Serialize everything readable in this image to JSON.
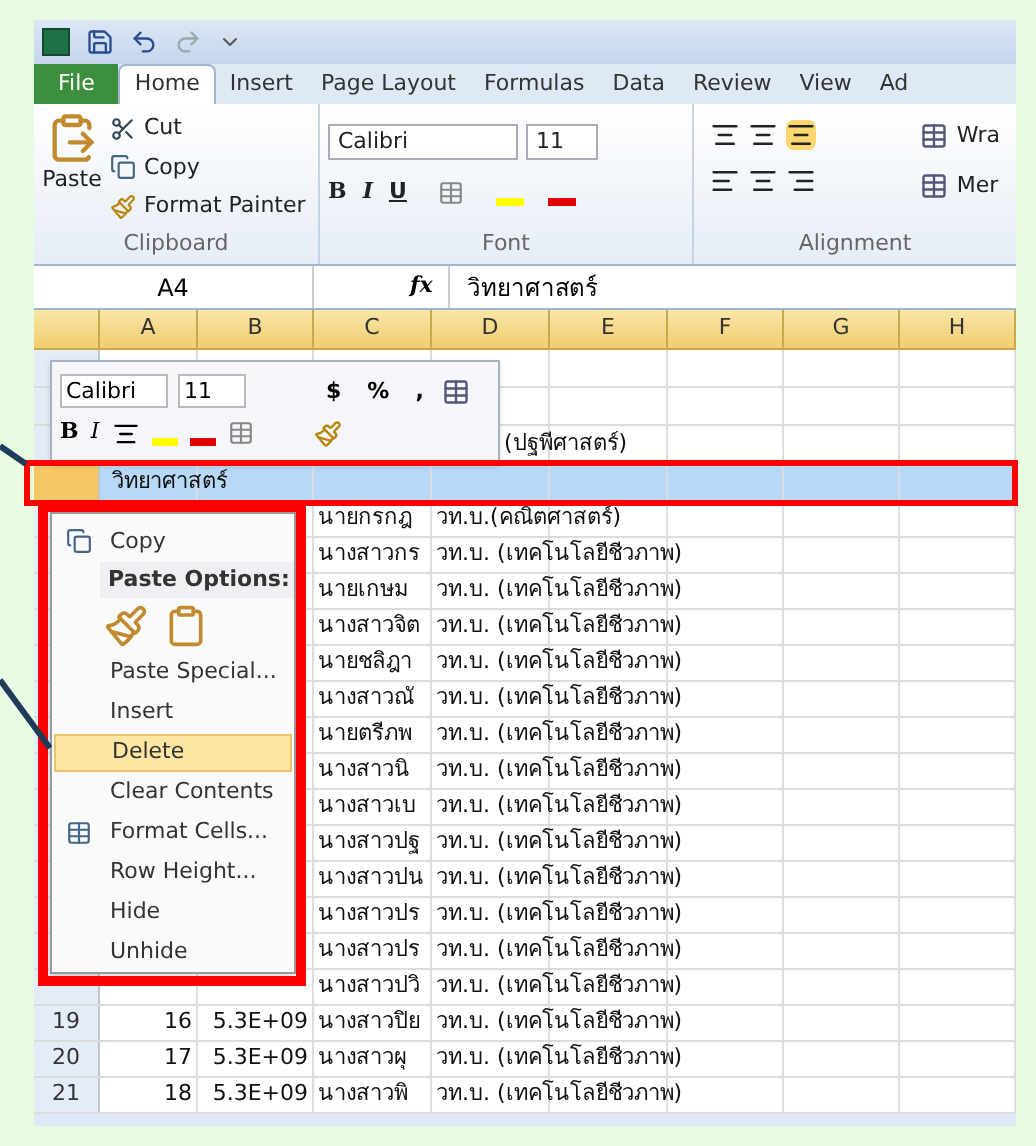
{
  "tabs": [
    {
      "label": "File",
      "kind": "file",
      "selected": false
    },
    {
      "label": "Home",
      "kind": "tab",
      "selected": true
    },
    {
      "label": "Insert",
      "kind": "tab",
      "selected": false
    },
    {
      "label": "Page Layout",
      "kind": "tab",
      "selected": false
    },
    {
      "label": "Formulas",
      "kind": "tab",
      "selected": false
    },
    {
      "label": "Data",
      "kind": "tab",
      "selected": false
    },
    {
      "label": "Review",
      "kind": "tab",
      "selected": false
    },
    {
      "label": "View",
      "kind": "tab",
      "selected": false
    },
    {
      "label": "Ad",
      "kind": "tab",
      "selected": false
    }
  ],
  "ribbon": {
    "clipboard": {
      "paste": "Paste",
      "cut": "Cut",
      "copy": "Copy",
      "format_painter": "Format Painter",
      "label": "Clipboard"
    },
    "font": {
      "name": "Calibri",
      "size": "11",
      "bold": "B",
      "italic": "I",
      "underline": "U",
      "label": "Font"
    },
    "alignment": {
      "wrap": "Wra",
      "merge": "Mer",
      "label": "Alignment"
    }
  },
  "formula_bar": {
    "name_box": "A4",
    "fx": "fx",
    "value": "วิทยาศาสตร์"
  },
  "columns": [
    "A",
    "B",
    "C",
    "D",
    "E",
    "F",
    "G",
    "H"
  ],
  "rows": [
    {
      "selected": false,
      "cells": {}
    },
    {
      "selected": false,
      "cells": {}
    },
    {
      "selected": false,
      "cells": {
        "D": "(ปฐพีศาสตร์)"
      }
    },
    {
      "selected": true,
      "cells": {
        "A": "วิทยาศาสตร์"
      }
    },
    {
      "selected": false,
      "cells": {
        "C": "นายกรกฎ",
        "D": "วท.บ.(คณิตศาสตร์)"
      }
    },
    {
      "selected": false,
      "cells": {
        "C": "นางสาวกร",
        "D": "วท.บ. (เทคโนโลยีชีวภาพ)"
      }
    },
    {
      "selected": false,
      "cells": {
        "C": "นายเกษม",
        "D": "วท.บ. (เทคโนโลยีชีวภาพ)"
      }
    },
    {
      "selected": false,
      "cells": {
        "C": "นางสาวจิต",
        "D": "วท.บ. (เทคโนโลยีชีวภาพ)"
      }
    },
    {
      "selected": false,
      "cells": {
        "C": "นายชลิฎา",
        "D": "วท.บ. (เทคโนโลยีชีวภาพ)"
      }
    },
    {
      "selected": false,
      "cells": {
        "C": "นางสาวณั",
        "D": "วท.บ. (เทคโนโลยีชีวภาพ)"
      }
    },
    {
      "selected": false,
      "cells": {
        "C": "นายตรีภพ",
        "D": "วท.บ. (เทคโนโลยีชีวภาพ)"
      }
    },
    {
      "selected": false,
      "cells": {
        "C": "นางสาวนิ",
        "D": "วท.บ. (เทคโนโลยีชีวภาพ)"
      }
    },
    {
      "selected": false,
      "cells": {
        "C": "นางสาวเบ",
        "D": "วท.บ. (เทคโนโลยีชีวภาพ)"
      }
    },
    {
      "selected": false,
      "cells": {
        "C": "นางสาวปฐ",
        "D": "วท.บ. (เทคโนโลยีชีวภาพ)"
      }
    },
    {
      "selected": false,
      "cells": {
        "C": "นางสาวปน",
        "D": "วท.บ. (เทคโนโลยีชีวภาพ)"
      }
    },
    {
      "selected": false,
      "cells": {
        "C": "นางสาวปร",
        "D": "วท.บ. (เทคโนโลยีชีวภาพ)"
      }
    },
    {
      "selected": false,
      "cells": {
        "C": "นางสาวปร",
        "D": "วท.บ. (เทคโนโลยีชีวภาพ)"
      }
    },
    {
      "selected": false,
      "cells": {
        "C": "นางสาวปวิ",
        "D": "วท.บ. (เทคโนโลยีชีวภาพ)"
      }
    },
    {
      "number": "19",
      "selected": false,
      "cells": {
        "A": "16",
        "B": "5.3E+09",
        "C": "นางสาวปิย",
        "D": "วท.บ. (เทคโนโลยีชีวภาพ)"
      }
    },
    {
      "number": "20",
      "selected": false,
      "cells": {
        "A": "17",
        "B": "5.3E+09",
        "C": "นางสาวผุ",
        "D": "วท.บ. (เทคโนโลยีชีวภาพ)"
      }
    },
    {
      "number": "21",
      "selected": false,
      "cells": {
        "A": "18",
        "B": "5.3E+09",
        "C": "นางสาวพิ",
        "D": "วท.บ. (เทคโนโลยีชีวภาพ)"
      }
    }
  ],
  "mini_toolbar": {
    "font": "Calibri",
    "size": "11",
    "currency": "$",
    "percent": "%",
    "comma": ",",
    "bold": "B",
    "italic": "I"
  },
  "context_menu": [
    {
      "kind": "icon_item",
      "label": "Copy",
      "selected": false
    },
    {
      "kind": "header",
      "label": "Paste Options:"
    },
    {
      "kind": "paste_icons"
    },
    {
      "kind": "item",
      "label": "Paste Special...",
      "selected": false
    },
    {
      "kind": "item",
      "label": "Insert",
      "selected": false
    },
    {
      "kind": "item",
      "label": "Delete",
      "selected": true
    },
    {
      "kind": "item",
      "label": "Clear Contents",
      "selected": false
    },
    {
      "kind": "icon_item",
      "label": "Format Cells...",
      "selected": false
    },
    {
      "kind": "item",
      "label": "Row Height...",
      "selected": false
    },
    {
      "kind": "item",
      "label": "Hide",
      "selected": false
    },
    {
      "kind": "item",
      "label": "Unhide",
      "selected": false
    }
  ]
}
